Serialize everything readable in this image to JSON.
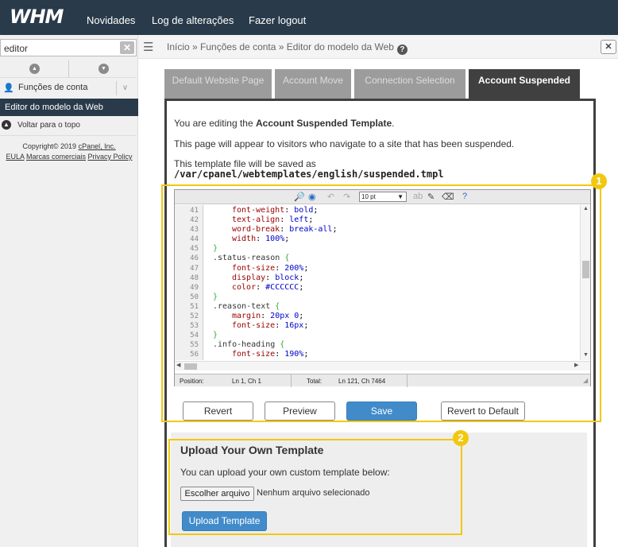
{
  "topbar": {
    "logo": "WHM",
    "nav": [
      "Novidades",
      "Log de alterações",
      "Fazer logout"
    ]
  },
  "sidebar": {
    "search_value": "editor",
    "category": "Funções de conta",
    "active_item": "Editor do modelo da Web",
    "back_label": "Voltar para o topo",
    "copyright": "Copyright© 2019",
    "copyright_link": "cPanel, Inc.",
    "links": [
      "EULA",
      "Marcas comerciais",
      "Privacy Policy"
    ]
  },
  "breadcrumb": {
    "text": "Início » Funções de conta » Editor do modelo da Web"
  },
  "tabs": [
    {
      "label": "Default Website Page",
      "active": false
    },
    {
      "label": "Account Move",
      "active": false
    },
    {
      "label": "Connection Selection",
      "active": false
    },
    {
      "label": "Account Suspended",
      "active": true
    }
  ],
  "content": {
    "editing_prefix": "You are editing the ",
    "editing_bold": "Account Suspended Template",
    "editing_suffix": ".",
    "appears": "This page will appear to visitors who navigate to a site that has been suspended.",
    "saved_as": "This template file will be saved as",
    "path": "/var/cpanel/webtemplates/english/suspended.tmpl"
  },
  "editor": {
    "font_size": "10 pt",
    "lines": [
      {
        "n": "41",
        "indent": 2,
        "prop": "font-weight",
        "val": "bold"
      },
      {
        "n": "42",
        "indent": 2,
        "prop": "text-align",
        "val": "left"
      },
      {
        "n": "43",
        "indent": 2,
        "prop": "word-break",
        "val": "break-all"
      },
      {
        "n": "44",
        "indent": 2,
        "prop": "width",
        "val": "100%"
      },
      {
        "n": "45",
        "indent": 1,
        "text": "}"
      },
      {
        "n": "46",
        "indent": 1,
        "sel": ".status-reason {"
      },
      {
        "n": "47",
        "indent": 2,
        "prop": "font-size",
        "val": "200%"
      },
      {
        "n": "48",
        "indent": 2,
        "prop": "display",
        "val": "block"
      },
      {
        "n": "49",
        "indent": 2,
        "prop": "color",
        "val": "#CCCCCC"
      },
      {
        "n": "50",
        "indent": 1,
        "text": "}"
      },
      {
        "n": "51",
        "indent": 1,
        "sel": ".reason-text {"
      },
      {
        "n": "52",
        "indent": 2,
        "prop": "margin",
        "val": "20px 0"
      },
      {
        "n": "53",
        "indent": 2,
        "prop": "font-size",
        "val": "16px"
      },
      {
        "n": "54",
        "indent": 1,
        "text": "}"
      },
      {
        "n": "55",
        "indent": 1,
        "sel": ".info-heading {"
      },
      {
        "n": "56",
        "indent": 2,
        "prop": "font-size",
        "val": "190%"
      }
    ],
    "status": {
      "position_label": "Position:",
      "position_value": "Ln 1, Ch 1",
      "total_label": "Total:",
      "total_value": "Ln 121, Ch 7464"
    }
  },
  "buttons": {
    "revert": "Revert",
    "preview": "Preview",
    "save": "Save",
    "revert_default": "Revert to Default"
  },
  "upload": {
    "title": "Upload Your Own Template",
    "desc": "You can upload your own custom template below:",
    "choose_file": "Escolher arquivo",
    "no_file": "Nenhum arquivo selecionado",
    "upload_button": "Upload Template"
  },
  "callouts": [
    "1",
    "2"
  ],
  "colors": {
    "topbar": "#293a4a",
    "accent": "#428bca",
    "callout": "#f2c80f",
    "tab_active": "#404040",
    "tab_inactive": "#9c9c9c"
  }
}
